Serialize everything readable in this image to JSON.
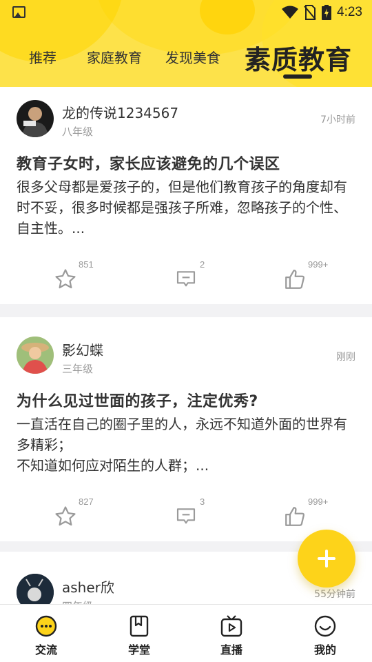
{
  "status_bar": {
    "time": "4:23",
    "icons": [
      "image-icon",
      "wifi-icon",
      "no-sim-icon",
      "battery-charging-icon"
    ]
  },
  "tabs": [
    {
      "label": "推荐",
      "active": false
    },
    {
      "label": "家庭教育",
      "active": false
    },
    {
      "label": "发现美食",
      "active": false
    },
    {
      "label": "素质教育",
      "active": true
    }
  ],
  "posts": [
    {
      "username": "龙的传说1234567",
      "grade": "八年级",
      "time": "7小时前",
      "title": "教育子女时，家长应该避免的几个误区",
      "body": "很多父母都是爱孩子的，但是他们教育孩子的角度却有时不妥，很多时候都是强孩子所难，忽略孩子的个性、自主性。...",
      "favorites": "851",
      "comments": "2",
      "likes": "999+"
    },
    {
      "username": "影幻蝶",
      "grade": "三年级",
      "time": "刚刚",
      "title": "为什么见过世面的孩子，注定优秀?",
      "body": "一直活在自己的圈子里的人，永远不知道外面的世界有多精彩；\n不知道如何应对陌生的人群；...",
      "favorites": "827",
      "comments": "3",
      "likes": "999+"
    },
    {
      "username": "asher欣",
      "grade": "四年级",
      "time": "55分钟前"
    }
  ],
  "bottom_nav": [
    {
      "label": "交流",
      "icon": "chat-bubble-icon",
      "active": true
    },
    {
      "label": "学堂",
      "icon": "book-icon",
      "active": false
    },
    {
      "label": "直播",
      "icon": "tv-play-icon",
      "active": false
    },
    {
      "label": "我的",
      "icon": "smiley-icon",
      "active": false
    }
  ],
  "colors": {
    "accent": "#fdd31a",
    "header_bg": "#fde24a",
    "text": "#333333",
    "muted": "#999999"
  }
}
